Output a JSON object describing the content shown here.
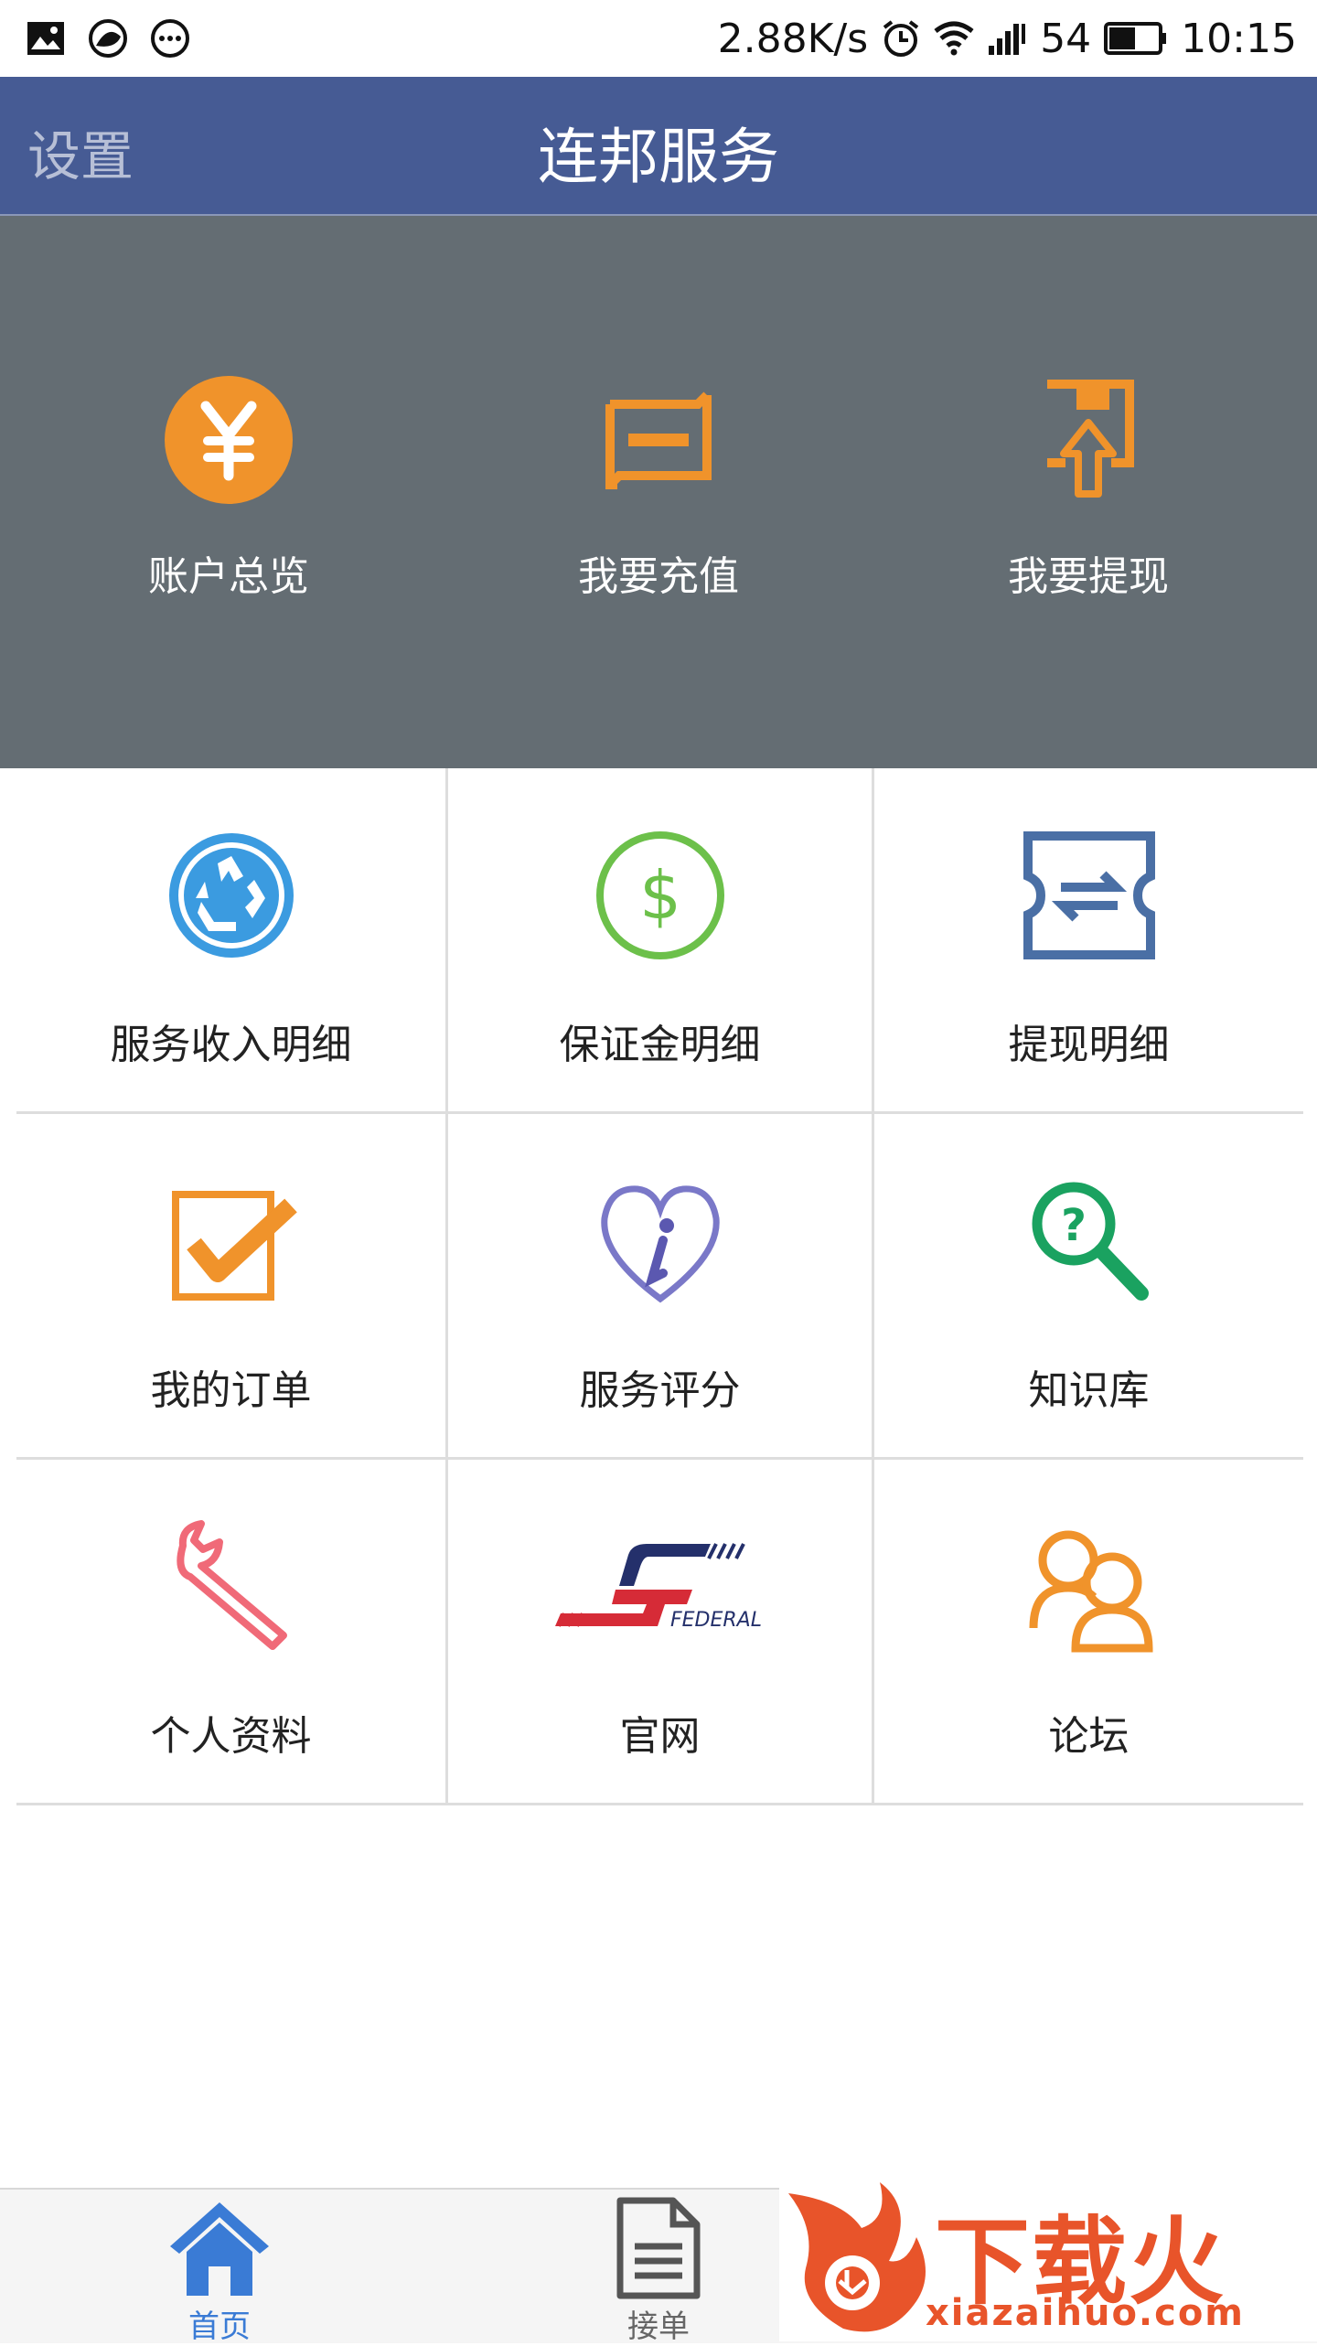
{
  "status_bar": {
    "speed": "2.88K/s",
    "battery": "54",
    "time": "10:15"
  },
  "app_bar": {
    "left_label": "设置",
    "title": "连邦服务"
  },
  "top_items": [
    {
      "label": "账户总览",
      "icon": "yen-coin-icon"
    },
    {
      "label": "我要充值",
      "icon": "recharge-icon"
    },
    {
      "label": "我要提现",
      "icon": "withdraw-icon"
    }
  ],
  "grid": [
    {
      "label": "服务收入明细",
      "icon": "recycle-icon"
    },
    {
      "label": "保证金明细",
      "icon": "dollar-coin-icon"
    },
    {
      "label": "提现明细",
      "icon": "exchange-ticket-icon"
    },
    {
      "label": "我的订单",
      "icon": "checkbox-icon"
    },
    {
      "label": "服务评分",
      "icon": "heart-info-icon"
    },
    {
      "label": "知识库",
      "icon": "question-search-icon"
    },
    {
      "label": "个人资料",
      "icon": "wrench-icon"
    },
    {
      "label": "官网",
      "icon": "federal-logo-icon"
    },
    {
      "label": "论坛",
      "icon": "users-icon"
    }
  ],
  "bottom_nav": [
    {
      "label": "首页",
      "icon": "home-icon",
      "active": true
    },
    {
      "label": "接单",
      "icon": "document-icon",
      "active": false
    }
  ],
  "watermark": {
    "text_cn": "下载火",
    "text_url": "xiazaihuo.com"
  },
  "colors": {
    "app_bar": "#465b94",
    "top_panel": "#646d73",
    "orange": "#f0932b",
    "active_tab": "#3a7bd5"
  }
}
